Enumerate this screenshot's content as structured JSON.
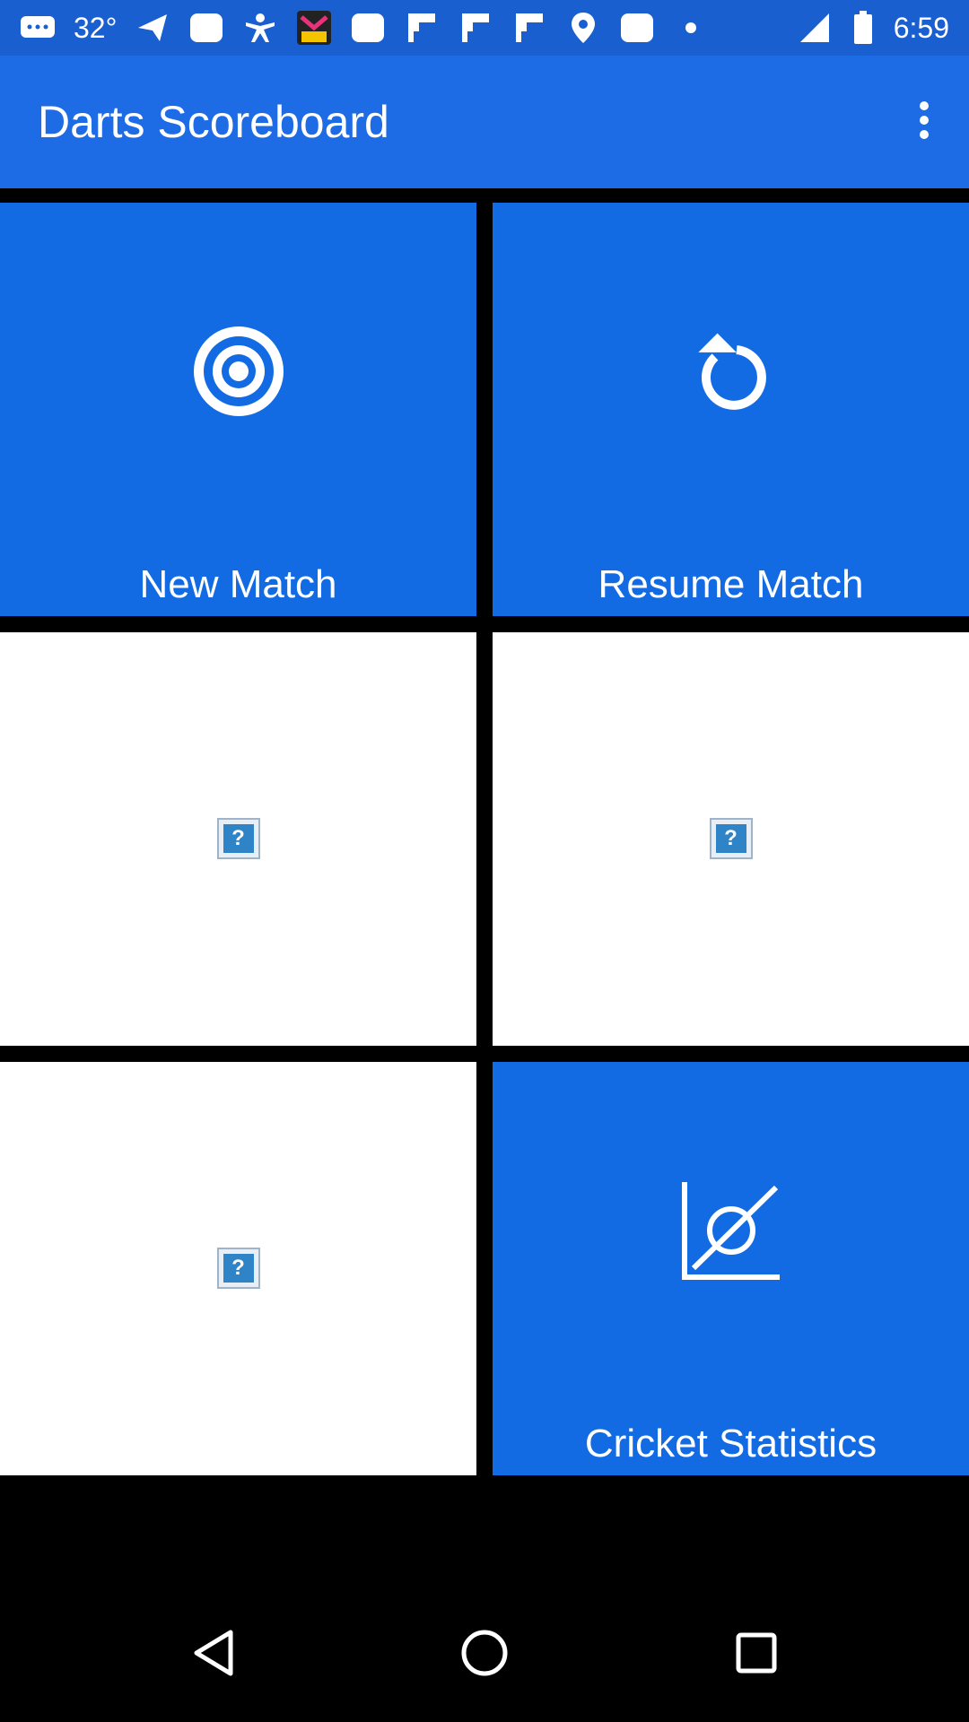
{
  "status_bar": {
    "temperature": "32°",
    "time": "6:59",
    "left_icons": [
      "messages-icon",
      "send-icon",
      "rounded-square-icon",
      "person-icon",
      "pop-app-icon",
      "rounded-square-icon",
      "flipboard-icon",
      "flipboard-icon",
      "flipboard-icon",
      "location-pin-icon",
      "rounded-square-icon",
      "dot-icon"
    ],
    "right_icons": [
      "signal-icon",
      "battery-icon"
    ]
  },
  "app_bar": {
    "title": "Darts Scoreboard",
    "overflow_icon": "more-vert-icon"
  },
  "tiles": [
    {
      "label": "New Match",
      "icon": "target-icon",
      "style": "blue"
    },
    {
      "label": "Resume Match",
      "icon": "refresh-icon",
      "style": "blue"
    },
    {
      "label": "",
      "icon": "broken-image-icon",
      "style": "white"
    },
    {
      "label": "",
      "icon": "broken-image-icon",
      "style": "white"
    },
    {
      "label": "",
      "icon": "broken-image-icon",
      "style": "white"
    },
    {
      "label": "Cricket Statistics",
      "icon": "chart-icon",
      "style": "blue"
    }
  ],
  "nav_bar": {
    "icons": [
      "back-icon",
      "home-icon",
      "recents-icon"
    ]
  },
  "colors": {
    "status_bar": "#1a5fcf",
    "app_bar": "#1e6be6",
    "tile_blue": "#136be4",
    "tile_white": "#ffffff",
    "background": "#000000"
  }
}
